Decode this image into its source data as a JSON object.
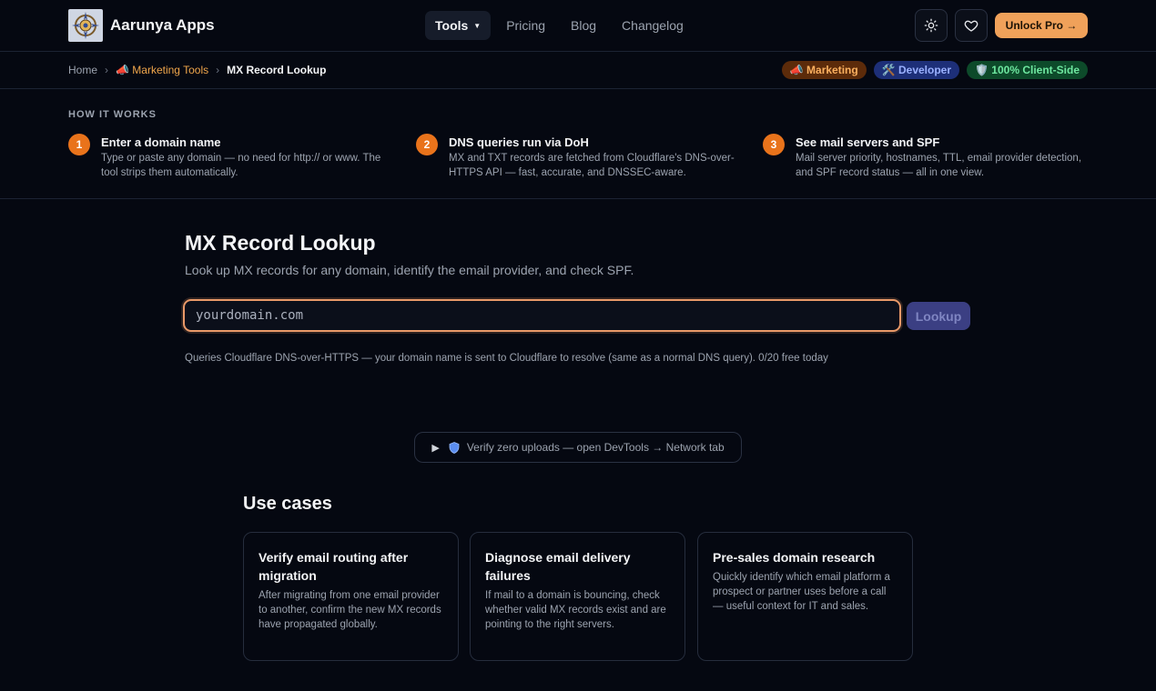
{
  "header": {
    "brand": "Aarunya Apps",
    "nav": [
      {
        "label": "Tools",
        "active": true,
        "has_dropdown": true
      },
      {
        "label": "Pricing"
      },
      {
        "label": "Blog"
      },
      {
        "label": "Changelog"
      }
    ],
    "theme_icon": "sun-icon",
    "favorite_icon": "heart-icon",
    "unlock_label": "Unlock Pro →"
  },
  "breadcrumb": {
    "home": "Home",
    "section": "📣 Marketing Tools",
    "current": "MX Record Lookup"
  },
  "badges": [
    "📣 Marketing",
    "🛠️ Developer",
    "🛡️ 100% Client-Side"
  ],
  "how_it_works": {
    "label": "HOW IT WORKS",
    "steps": [
      {
        "num": "1",
        "title": "Enter a domain name",
        "desc": "Type or paste any domain — no need for http:// or www. The tool strips them automatically."
      },
      {
        "num": "2",
        "title": "DNS queries run via DoH",
        "desc": "MX and TXT records are fetched from Cloudflare's DNS-over-HTTPS API — fast, accurate, and DNSSEC-aware."
      },
      {
        "num": "3",
        "title": "See mail servers and SPF",
        "desc": "Mail server priority, hostnames, TTL, email provider detection, and SPF record status — all in one view."
      }
    ]
  },
  "main": {
    "title": "MX Record Lookup",
    "subtitle": "Look up MX records for any domain, identify the email provider, and check SPF.",
    "search_placeholder": "yourdomain.com",
    "search_value": "",
    "lookup_label": "Lookup",
    "note": "Queries Cloudflare DNS-over-HTTPS — your domain name is sent to Cloudflare to resolve (same as a normal DNS query). 0/20 free today",
    "verify_label": "Verify zero uploads — open DevTools → Network tab"
  },
  "use_cases": {
    "title": "Use cases",
    "cards": [
      {
        "title": "Verify email routing after migration",
        "body": "After migrating from one email provider to another, confirm the new MX records have propagated globally."
      },
      {
        "title": "Diagnose email delivery failures",
        "body": "If mail to a domain is bouncing, check whether valid MX records exist and are pointing to the right servers."
      },
      {
        "title": "Pre-sales domain research",
        "body": "Quickly identify which email platform a prospect or partner uses before a call — useful context for IT and sales."
      }
    ]
  },
  "colors": {
    "background": "#050811",
    "accent": "#f0a15a",
    "step_circle": "#e9731b",
    "input_border": "#e99968"
  }
}
